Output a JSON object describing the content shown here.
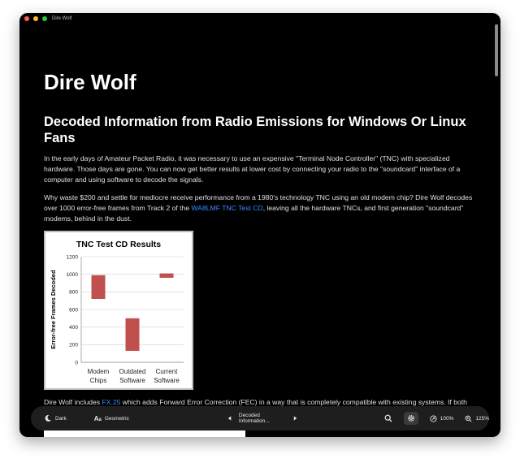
{
  "window": {
    "title": "Dire Wolf"
  },
  "article": {
    "h1": "Dire Wolf",
    "h2": "Decoded Information from Radio Emissions for Windows Or Linux Fans",
    "p1": "In the early days of Amateur Packet Radio, it was necessary to use an expensive \"Terminal Node Controller\" (TNC) with specialized hardware. Those days are gone. You can now get better results at lower cost by connecting your radio to the \"soundcard\" interface of a computer and using software to decode the signals.",
    "p2_before": "Why waste $200 and settle for mediocre receive performance from a 1980's technology TNC using an old modem chip? Dire Wolf decodes over 1000 error-free frames from Track 2 of the ",
    "p2_link": "WA8LMF TNC Test CD",
    "p2_after": ", leaving all the hardware TNCs, and first generation \"soundcard\" modems, behind in the dust.",
    "p3_before": "Dire Wolf includes ",
    "p3_link": "FX.25",
    "p3_after": " which adds Forward Error Correction (FEC) in a way that is completely compatible with existing systems. If both ends are capable of FX.25, your information will continue to get through under conditions where regular AX.25 is completely useless. This was originally developed for satellites and is now seeing widespread use on HF."
  },
  "chart_data": {
    "type": "bar",
    "title": "TNC Test  CD  Results",
    "ylabel": "Error-free  Frames  Decoded",
    "ylim": [
      0,
      1200
    ],
    "yticks": [
      "0",
      "200",
      "400",
      "600",
      "800",
      "1000",
      "1200"
    ],
    "categories": [
      {
        "line1": "Modem",
        "line2": "Chips"
      },
      {
        "line1": "Outdated",
        "line2": "Software"
      },
      {
        "line1": "Current",
        "line2": "Software"
      }
    ],
    "ranges": [
      [
        720,
        990
      ],
      [
        130,
        500
      ],
      [
        960,
        1010
      ]
    ],
    "bar_color": "#c0504d"
  },
  "toolbar": {
    "theme_label": "Dark",
    "font_label": "Geometric",
    "section_label": "Decoded Information...",
    "zoom_actual": "100%",
    "zoom_level": "125%"
  }
}
